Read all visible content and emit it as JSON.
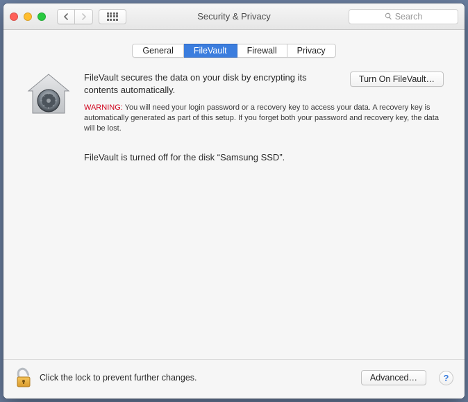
{
  "window": {
    "title": "Security & Privacy"
  },
  "toolbar": {
    "search_placeholder": "Search"
  },
  "tabs": {
    "general": "General",
    "filevault": "FileVault",
    "firewall": "Firewall",
    "privacy": "Privacy",
    "active": "filevault"
  },
  "filevault": {
    "headline": "FileVault secures the data on your disk by encrypting its contents automatically.",
    "turn_on_label": "Turn On FileVault…",
    "warning_label": "WARNING:",
    "warning_text": " You will need your login password or a recovery key to access your data. A recovery key is automatically generated as part of this setup. If you forget both your password and recovery key, the data will be lost.",
    "status": "FileVault is turned off for the disk “Samsung SSD”."
  },
  "footer": {
    "lock_text": "Click the lock to prevent further changes.",
    "advanced_label": "Advanced…"
  }
}
